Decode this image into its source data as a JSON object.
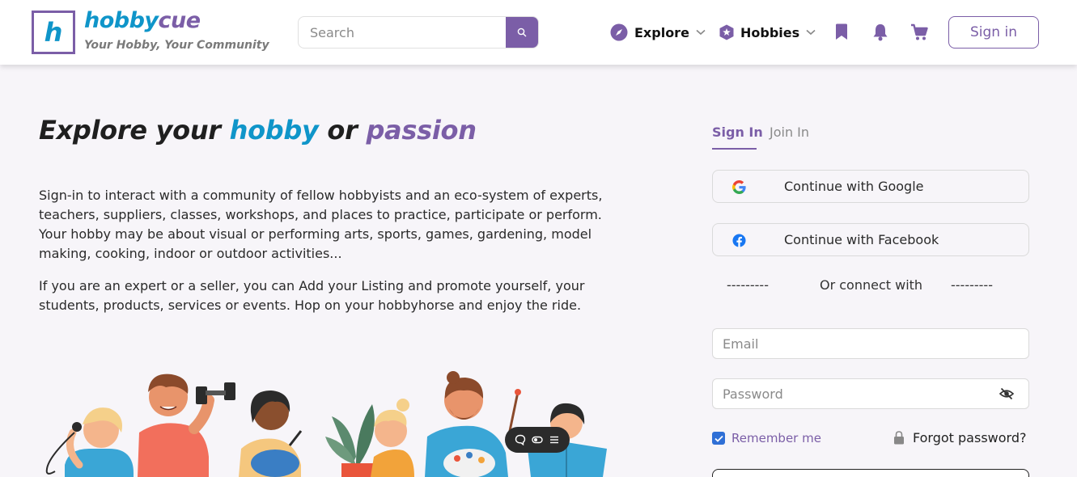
{
  "brand": {
    "logo_letter": "h",
    "name_part1": "hobby",
    "name_part2": "cue",
    "tagline": "Your Hobby, Your Community",
    "primary_color": "#7b5ea7",
    "accent_color": "#0f95c9"
  },
  "header": {
    "search": {
      "placeholder": "Search",
      "icon": "search-icon"
    },
    "nav": [
      {
        "label": "Explore",
        "icon": "compass-icon",
        "dropdown": true
      },
      {
        "label": "Hobbies",
        "icon": "hexagon-star-icon",
        "dropdown": true
      }
    ],
    "icons": [
      "bookmark-icon",
      "bell-icon",
      "cart-icon"
    ],
    "signin_label": "Sign in"
  },
  "hero": {
    "title_part1": "Explore your ",
    "title_part2": "hobby",
    "title_part3": " or ",
    "title_part4": "passion",
    "paragraph1": "Sign-in to interact with a community of fellow hobbyists and an eco-system of experts, teachers, suppliers, classes, workshops, and places to practice, participate or perform. Your hobby may be about visual or performing arts, sports, games, gardening, model making, cooking, indoor or outdoor activities...",
    "paragraph2": "If you are an expert or a seller, you can Add your Listing and promote yourself, your students, products, services or events. Hop on your hobbyhorse and enjoy the ride."
  },
  "auth": {
    "tabs": [
      {
        "label": "Sign In",
        "active": true
      },
      {
        "label": "Join In",
        "active": false
      }
    ],
    "google_label": "Continue with Google",
    "facebook_label": "Continue with Facebook",
    "divider_left": "---------",
    "divider_text": "Or connect with",
    "divider_right": "---------",
    "email": {
      "placeholder": "Email",
      "value": ""
    },
    "password": {
      "placeholder": "Password",
      "value": ""
    },
    "remember_label": "Remember me",
    "remember_checked": true,
    "forgot_label": "Forgot password?"
  }
}
